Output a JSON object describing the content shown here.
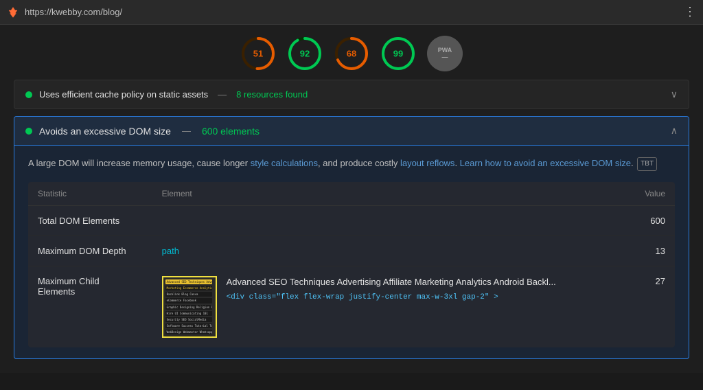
{
  "topbar": {
    "url": "https://kwebby.com/blog/",
    "menu_icon": "⋮"
  },
  "scores": [
    {
      "id": "performance",
      "value": 51,
      "color": "#e65c00",
      "track_color": "#3a2000",
      "label": "51"
    },
    {
      "id": "accessibility",
      "value": 92,
      "color": "#00c853",
      "track_color": "#003300",
      "label": "92"
    },
    {
      "id": "best-practices",
      "value": 68,
      "color": "#e65c00",
      "track_color": "#3a2000",
      "label": "68"
    },
    {
      "id": "seo",
      "value": 99,
      "color": "#00c853",
      "track_color": "#003300",
      "label": "99"
    }
  ],
  "pwa": {
    "label": "PWA",
    "dash": "—"
  },
  "cache_row": {
    "text": "Uses efficient cache policy on static assets",
    "separator": "—",
    "count": "8 resources found",
    "chevron": "∨"
  },
  "dom_panel": {
    "header_text": "Avoids an excessive DOM size",
    "separator": "—",
    "count": "600 elements",
    "chevron": "∧",
    "description_text": "A large DOM will increase memory usage, cause longer ",
    "link1_text": "style calculations",
    "description_mid": ", and produce costly ",
    "link2_text": "layout reflows",
    "description_end": ". ",
    "link3_text": "Learn how to avoid an excessive DOM size",
    "tbt_badge": "TBT",
    "table": {
      "columns": [
        {
          "label": "Statistic",
          "align": "left"
        },
        {
          "label": "Element",
          "align": "left"
        },
        {
          "label": "Value",
          "align": "right"
        }
      ],
      "rows": [
        {
          "statistic": "Total DOM Elements",
          "element": "",
          "value": "600",
          "has_thumbnail": false
        },
        {
          "statistic": "Maximum DOM Depth",
          "element": "path",
          "value": "13",
          "has_thumbnail": false
        },
        {
          "statistic": "Maximum Child\nElements",
          "element_title": "Advanced SEO Techniques Advertising Affiliate Marketing Analytics Android Backl...",
          "element_code": "<div class=\"flex flex-wrap justify-center max-w-3xl gap-2\" >",
          "value": "27",
          "has_thumbnail": true
        }
      ]
    }
  }
}
